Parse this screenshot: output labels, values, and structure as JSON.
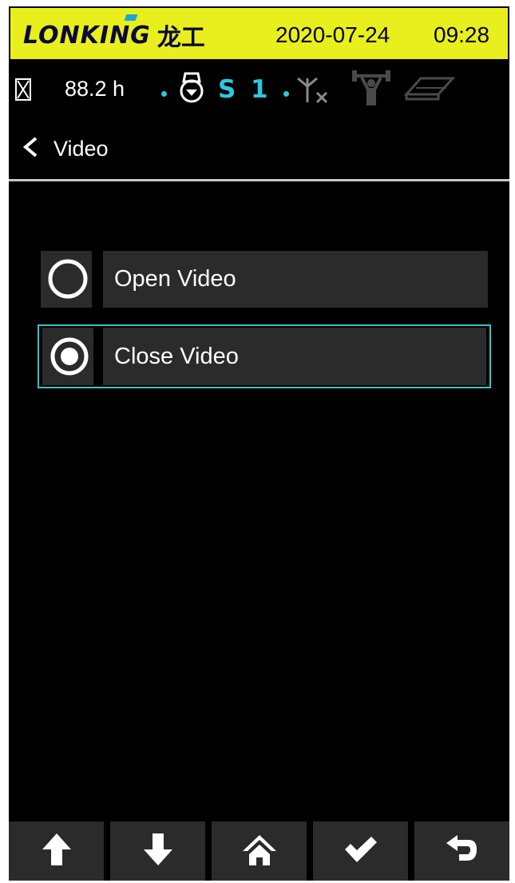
{
  "topbar": {
    "brand_latin": "LONKING",
    "brand_cn": "龙工",
    "date": "2020-07-24",
    "time": "09:28",
    "background_color": "#e8ef1c"
  },
  "status": {
    "hours": "88.2 h",
    "gear_letter": "S",
    "gear_number": "1",
    "icons": [
      "hourglass-icon",
      "bucket-icon",
      "antenna-no-signal-icon",
      "lift-icon",
      "book-icon"
    ],
    "accent_color": "#2ec7e0"
  },
  "header": {
    "back_symbol": "<",
    "title": "Video"
  },
  "options": [
    {
      "label": "Open Video",
      "selected": false
    },
    {
      "label": "Close Video",
      "selected": true
    }
  ],
  "bottom_nav": {
    "buttons": [
      "arrow-up-icon",
      "arrow-down-icon",
      "home-icon",
      "check-icon",
      "return-icon"
    ]
  },
  "selection_border_color": "#2ec7c9"
}
